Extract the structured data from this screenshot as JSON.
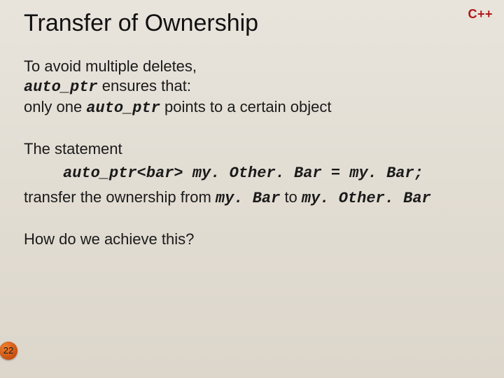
{
  "badge": "C++",
  "title": "Transfer of Ownership",
  "p1_l1": "To avoid multiple deletes,",
  "p1_code1": "auto_ptr",
  "p1_l2b": " ensures that:",
  "p1_l3a": "only one ",
  "p1_code2": "auto_ptr",
  "p1_l3b": " points to a certain object",
  "p2": "The statement",
  "codeLine": "auto_ptr<bar> my. Other. Bar = my. Bar;",
  "p3a": "transfer the ownership from ",
  "p3code1": "my. Bar",
  "p3b": " to ",
  "p3code2": "my. Other. Bar",
  "p4": "How do we achieve this?",
  "pageNumber": "22"
}
